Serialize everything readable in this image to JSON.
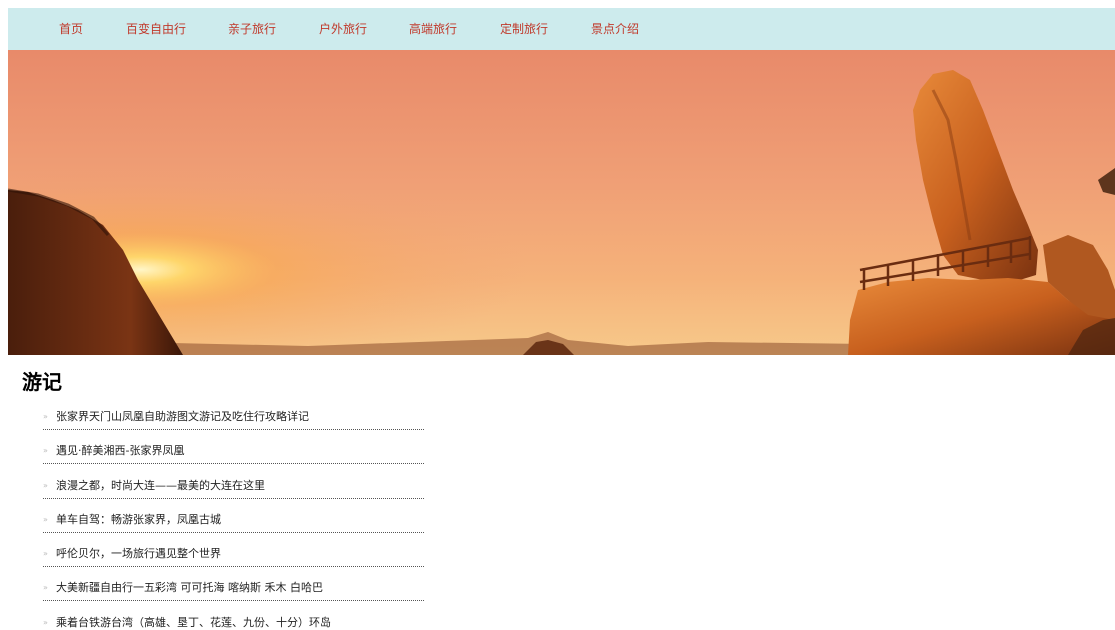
{
  "nav": {
    "items": [
      {
        "label": "首页"
      },
      {
        "label": "百变自由行"
      },
      {
        "label": "亲子旅行"
      },
      {
        "label": "户外旅行"
      },
      {
        "label": "高端旅行"
      },
      {
        "label": "定制旅行"
      },
      {
        "label": "景点介绍"
      }
    ]
  },
  "banner": {
    "description_icon": "sunset-mountain-photo"
  },
  "section": {
    "title": "游记"
  },
  "articles": [
    {
      "bullet": "»",
      "title": "张家界天门山凤凰自助游图文游记及吃住行攻略详记"
    },
    {
      "bullet": "»",
      "title": "遇见·醉美湘西-张家界凤凰"
    },
    {
      "bullet": "»",
      "title": "浪漫之都，时尚大连——最美的大连在这里"
    },
    {
      "bullet": "»",
      "title": "单车自驾：畅游张家界，凤凰古城"
    },
    {
      "bullet": "»",
      "title": "呼伦贝尔，一场旅行遇见整个世界"
    },
    {
      "bullet": "»",
      "title": "大美新疆自由行一五彩湾 可可托海 喀纳斯 禾木 白哈巴"
    },
    {
      "bullet": "»",
      "title": "乘着台铁游台湾（高雄、垦丁、花莲、九份、十分）环岛"
    }
  ],
  "colors": {
    "nav_bg": "#cdebed",
    "nav_text": "#c0392b",
    "title": "#000000",
    "link": "#222222"
  }
}
